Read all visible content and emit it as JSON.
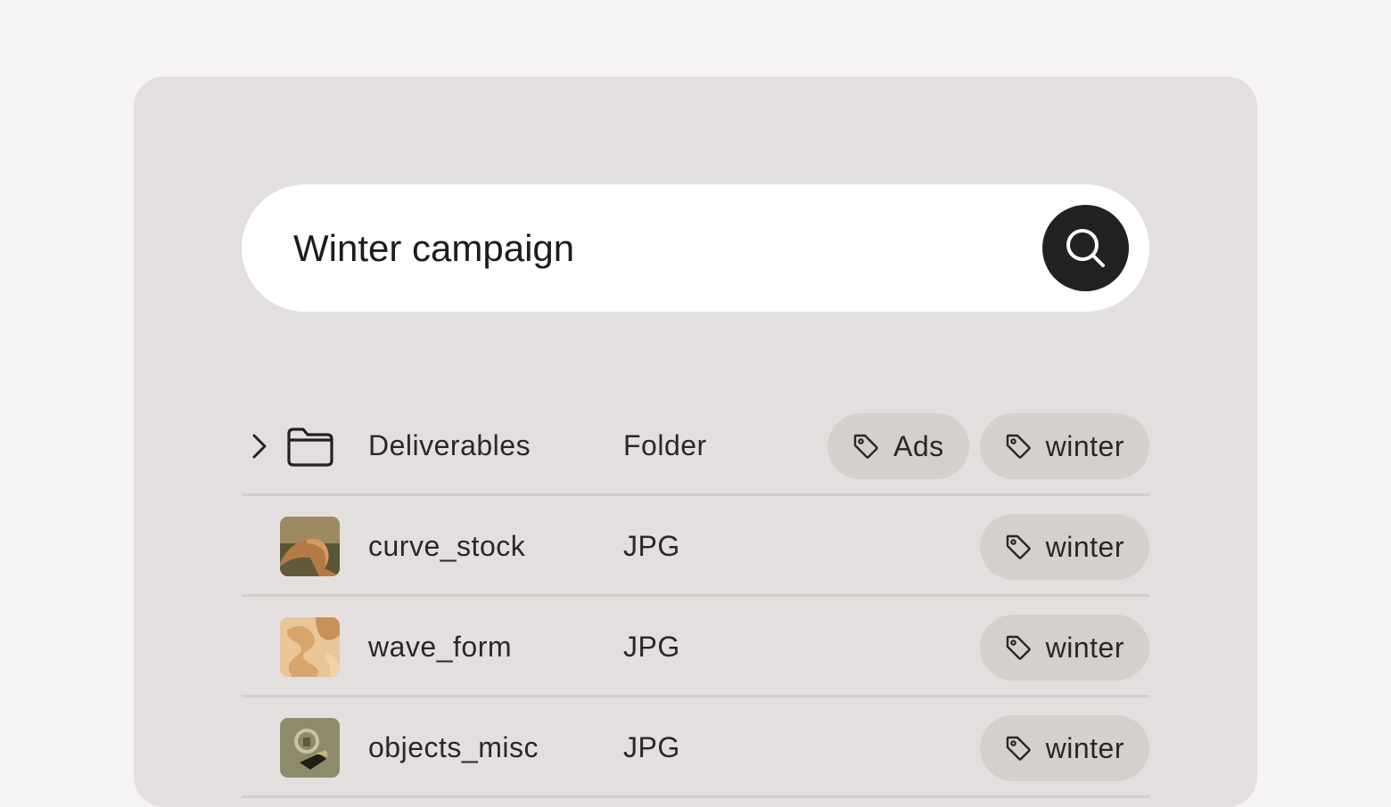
{
  "search": {
    "value": "Winter campaign",
    "button_icon": "search-icon"
  },
  "colors": {
    "page_bg": "#f5f4f2",
    "panel_bg": "#e4dfdf",
    "search_bg": "#ffffff",
    "button_bg": "#222020",
    "tag_bg": "#d5cfce"
  },
  "results": [
    {
      "name": "Deliverables",
      "type": "Folder",
      "icon": "folder-icon",
      "expandable": true,
      "tags": [
        "Ads",
        "winter"
      ]
    },
    {
      "name": "curve_stock",
      "type": "JPG",
      "icon": "image-thumbnail",
      "tags": [
        "winter"
      ]
    },
    {
      "name": "wave_form",
      "type": "JPG",
      "icon": "image-thumbnail",
      "tags": [
        "winter"
      ]
    },
    {
      "name": "objects_misc",
      "type": "JPG",
      "icon": "image-thumbnail",
      "tags": [
        "winter"
      ]
    }
  ]
}
